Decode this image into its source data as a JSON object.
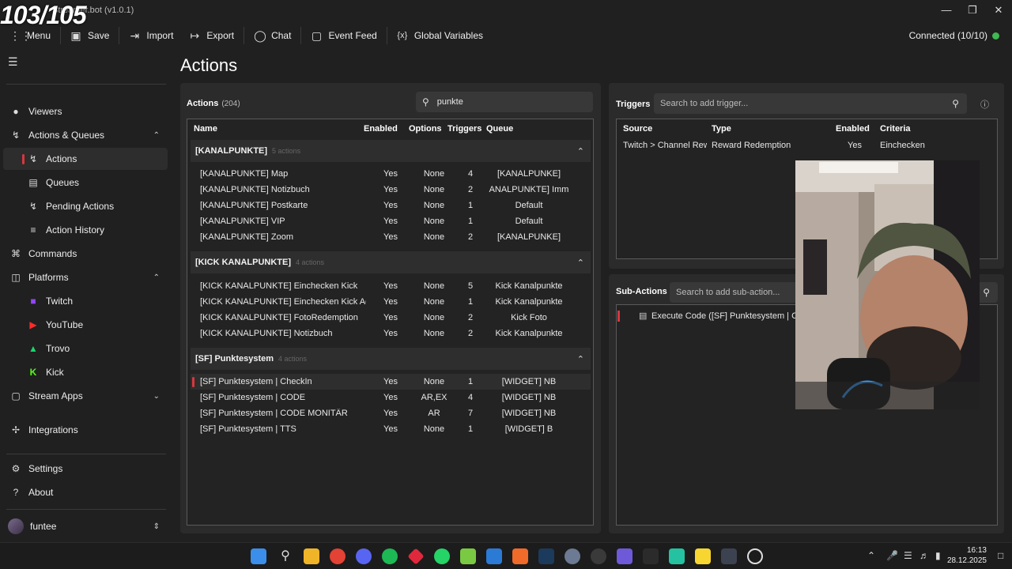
{
  "overlay_counter": "103/105",
  "app_title": "Streamer.bot (v1.0.1)",
  "toolbar": {
    "menu": "Menu",
    "save": "Save",
    "import": "Import",
    "export": "Export",
    "chat": "Chat",
    "event_feed": "Event Feed",
    "global_variables": "Global Variables"
  },
  "connection": {
    "label": "Connected (10/10)",
    "color": "#3fb950"
  },
  "sidebar": {
    "viewers": "Viewers",
    "actions_queues": "Actions & Queues",
    "actions": "Actions",
    "queues": "Queues",
    "pending_actions": "Pending Actions",
    "action_history": "Action History",
    "commands": "Commands",
    "platforms": "Platforms",
    "twitch": "Twitch",
    "youtube": "YouTube",
    "trovo": "Trovo",
    "kick": "Kick",
    "stream_apps": "Stream Apps",
    "integrations": "Integrations",
    "settings": "Settings",
    "about": "About",
    "user": "funtee"
  },
  "page_title": "Actions",
  "actions_panel": {
    "title": "Actions",
    "count": "(204)",
    "search_value": "punkte",
    "columns": {
      "name": "Name",
      "enabled": "Enabled",
      "options": "Options",
      "triggers": "Triggers",
      "queue": "Queue"
    },
    "groups": [
      {
        "name": "[KANALPUNKTE]",
        "count": "5 actions",
        "rows": [
          {
            "name": "[KANALPUNKTE] Map",
            "enabled": "Yes",
            "options": "None",
            "triggers": "4",
            "queue": "[KANALPUNKE]"
          },
          {
            "name": "[KANALPUNKTE] Notizbuch",
            "enabled": "Yes",
            "options": "None",
            "triggers": "2",
            "queue": "ANALPUNKTE] Imm"
          },
          {
            "name": "[KANALPUNKTE] Postkarte",
            "enabled": "Yes",
            "options": "None",
            "triggers": "1",
            "queue": "Default"
          },
          {
            "name": "[KANALPUNKTE] VIP",
            "enabled": "Yes",
            "options": "None",
            "triggers": "1",
            "queue": "Default"
          },
          {
            "name": "[KANALPUNKTE] Zoom",
            "enabled": "Yes",
            "options": "None",
            "triggers": "2",
            "queue": "[KANALPUNKE]"
          }
        ]
      },
      {
        "name": "[KICK KANALPUNKTE]",
        "count": "4 actions",
        "rows": [
          {
            "name": "[KICK KANALPUNKTE] Einchecken Kick",
            "enabled": "Yes",
            "options": "None",
            "triggers": "5",
            "queue": "Kick Kanalpunkte"
          },
          {
            "name": "[KICK KANALPUNKTE] Einchecken Kick Add",
            "enabled": "Yes",
            "options": "None",
            "triggers": "1",
            "queue": "Kick Kanalpunkte"
          },
          {
            "name": "[KICK KANALPUNKTE] FotoRedemption",
            "enabled": "Yes",
            "options": "None",
            "triggers": "2",
            "queue": "Kick Foto"
          },
          {
            "name": "[KICK KANALPUNKTE] Notizbuch",
            "enabled": "Yes",
            "options": "None",
            "triggers": "2",
            "queue": "Kick Kanalpunkte"
          }
        ]
      },
      {
        "name": "[SF] Punktesystem",
        "count": "4 actions",
        "rows": [
          {
            "name": "[SF] Punktesystem | CheckIn",
            "enabled": "Yes",
            "options": "None",
            "triggers": "1",
            "queue": "[WIDGET] NB"
          },
          {
            "name": "[SF] Punktesystem | CODE",
            "enabled": "Yes",
            "options": "AR,EX",
            "triggers": "4",
            "queue": "[WIDGET] NB"
          },
          {
            "name": "[SF] Punktesystem | CODE MONITÄR",
            "enabled": "Yes",
            "options": "AR",
            "triggers": "7",
            "queue": "[WIDGET] NB"
          },
          {
            "name": "[SF] Punktesystem | TTS",
            "enabled": "Yes",
            "options": "None",
            "triggers": "1",
            "queue": "[WIDGET] B"
          }
        ]
      }
    ]
  },
  "triggers_panel": {
    "title": "Triggers",
    "search_placeholder": "Search to add trigger...",
    "columns": {
      "source": "Source",
      "type": "Type",
      "enabled": "Enabled",
      "criteria": "Criteria"
    },
    "rows": [
      {
        "source": "Twitch > Channel Rewa",
        "type": "Reward Redemption",
        "enabled": "Yes",
        "criteria": "Einchecken"
      }
    ]
  },
  "subactions_panel": {
    "title": "Sub-Actions",
    "search_placeholder": "Search to add sub-action...",
    "item": "Execute Code ([SF] Punktesystem | CheckIn"
  },
  "taskbar": {
    "time": "16:13",
    "date": "28.12.2025"
  }
}
